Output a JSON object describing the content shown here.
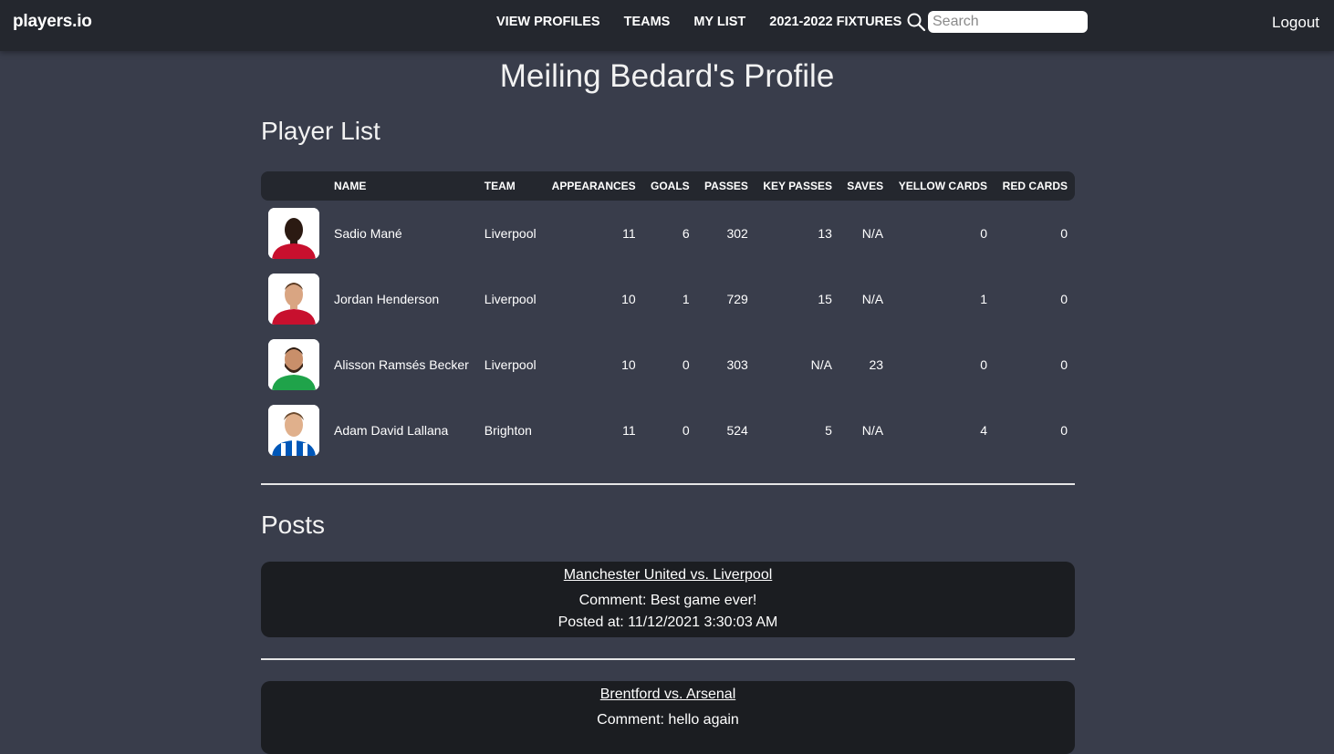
{
  "nav": {
    "brand": "players.io",
    "links": [
      "VIEW PROFILES",
      "TEAMS",
      "MY LIST",
      "2021-2022 FIXTURES"
    ],
    "search_placeholder": "Search",
    "logout": "Logout"
  },
  "profile": {
    "title": "Meiling Bedard's Profile"
  },
  "player_list": {
    "title": "Player List",
    "headers": [
      "",
      "NAME",
      "TEAM",
      "APPEARANCES",
      "GOALS",
      "PASSES",
      "KEY PASSES",
      "SAVES",
      "YELLOW CARDS",
      "RED CARDS"
    ],
    "rows": [
      {
        "name": "Sadio Mané",
        "team": "Liverpool",
        "appearances": "11",
        "goals": "6",
        "passes": "302",
        "key_passes": "13",
        "saves": "N/A",
        "yellow_cards": "0",
        "red_cards": "0",
        "kit_color": "#c8102e"
      },
      {
        "name": "Jordan Henderson",
        "team": "Liverpool",
        "appearances": "10",
        "goals": "1",
        "passes": "729",
        "key_passes": "15",
        "saves": "N/A",
        "yellow_cards": "1",
        "red_cards": "0",
        "kit_color": "#c8102e"
      },
      {
        "name": "Alisson Ramsés Becker",
        "team": "Liverpool",
        "appearances": "10",
        "goals": "0",
        "passes": "303",
        "key_passes": "N/A",
        "saves": "23",
        "yellow_cards": "0",
        "red_cards": "0",
        "kit_color": "#1fa34a"
      },
      {
        "name": "Adam David Lallana",
        "team": "Brighton",
        "appearances": "11",
        "goals": "0",
        "passes": "524",
        "key_passes": "5",
        "saves": "N/A",
        "yellow_cards": "4",
        "red_cards": "0",
        "kit_color": "#0057b8"
      }
    ]
  },
  "posts": {
    "title": "Posts",
    "items": [
      {
        "fixture": "Manchester United vs. Liverpool",
        "comment": "Comment: Best game ever!",
        "posted_at": "Posted at: 11/12/2021 3:30:03 AM"
      },
      {
        "fixture": "Brentford vs. Arsenal",
        "comment": "Comment: hello again",
        "posted_at": ""
      }
    ]
  },
  "icons": {
    "search": "search-icon"
  }
}
